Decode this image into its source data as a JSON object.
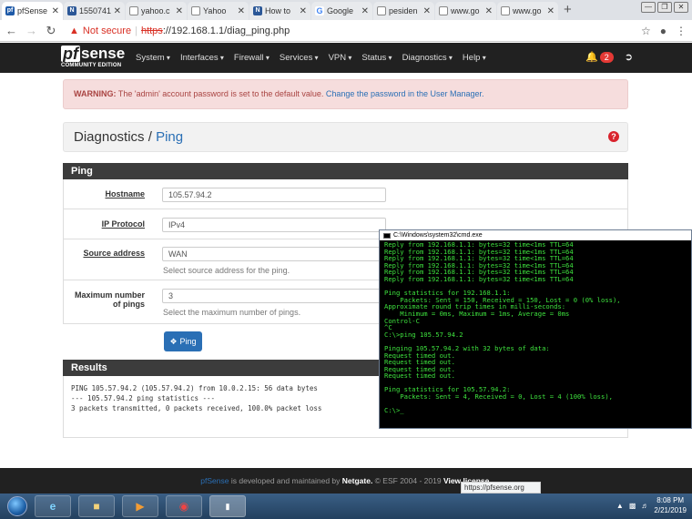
{
  "browser": {
    "tabs": [
      {
        "title": "pfSense",
        "icon": "pfsense-favicon",
        "active": true
      },
      {
        "title": "1550741",
        "icon": "netgate-favicon"
      },
      {
        "title": "yahoo.c",
        "icon": "document-favicon"
      },
      {
        "title": "Yahoo",
        "icon": "document-favicon"
      },
      {
        "title": "How to",
        "icon": "netgate-favicon"
      },
      {
        "title": "Google",
        "icon": "google-favicon"
      },
      {
        "title": "pesiden",
        "icon": "document-favicon"
      },
      {
        "title": "www.go",
        "icon": "document-favicon"
      },
      {
        "title": "www.go",
        "icon": "document-favicon"
      }
    ],
    "new_tab": "+",
    "security_label": "Not secure",
    "url_scheme": "https",
    "url_rest": "://192.168.1.1/diag_ping.php"
  },
  "nav": {
    "logo_pf": "pf",
    "logo_sense": "sense",
    "logo_edition": "COMMUNITY EDITION",
    "menu": [
      "System",
      "Interfaces",
      "Firewall",
      "Services",
      "VPN",
      "Status",
      "Diagnostics",
      "Help"
    ],
    "notification_count": "2"
  },
  "alert": {
    "prefix": "WARNING:",
    "message": " The 'admin' account password is set to the default value. ",
    "link": "Change the password in the User Manager."
  },
  "breadcrumb": {
    "section": "Diagnostics",
    "separator": " / ",
    "page": "Ping"
  },
  "ping_panel": {
    "title": "Ping",
    "hostname_label": "Hostname",
    "hostname_value": "105.57.94.2",
    "protocol_label": "IP Protocol",
    "protocol_value": "IPv4",
    "source_label": "Source address",
    "source_value": "WAN",
    "source_help": "Select source address for the ping.",
    "count_label_1": "Maximum number",
    "count_label_2": "of pings",
    "count_value": "3",
    "count_help": "Select the maximum number of pings.",
    "button_label": "Ping"
  },
  "results": {
    "title": "Results",
    "lines": [
      "PING 105.57.94.2 (105.57.94.2) from 10.0.2.15: 56 data bytes",
      "",
      "--- 105.57.94.2 ping statistics ---",
      "3 packets transmitted, 0 packets received, 100.0% packet loss"
    ]
  },
  "footer": {
    "brand": "pfSense",
    "text1": " is developed and maintained by ",
    "company": "Netgate.",
    "text2": " © ESF 2004 - 2019 ",
    "license": "View license."
  },
  "status_url": "https://pfsense.org",
  "cmd": {
    "title": "C:\\Windows\\system32\\cmd.exe",
    "lines": [
      "Reply from 192.168.1.1: bytes=32 time<1ms TTL=64",
      "Reply from 192.168.1.1: bytes=32 time<1ms TTL=64",
      "Reply from 192.168.1.1: bytes=32 time<1ms TTL=64",
      "Reply from 192.168.1.1: bytes=32 time<1ms TTL=64",
      "Reply from 192.168.1.1: bytes=32 time<1ms TTL=64",
      "Reply from 192.168.1.1: bytes=32 time<1ms TTL=64",
      "",
      "Ping statistics for 192.168.1.1:",
      "    Packets: Sent = 150, Received = 150, Lost = 0 (0% loss),",
      "Approximate round trip times in milli-seconds:",
      "    Minimum = 0ms, Maximum = 1ms, Average = 0ms",
      "Control-C",
      "^C",
      "C:\\>ping 105.57.94.2",
      "",
      "Pinging 105.57.94.2 with 32 bytes of data:",
      "Request timed out.",
      "Request timed out.",
      "Request timed out.",
      "Request timed out.",
      "",
      "Ping statistics for 105.57.94.2:",
      "    Packets: Sent = 4, Received = 0, Lost = 4 (100% loss),",
      "",
      "C:\\>_"
    ]
  },
  "taskbar": {
    "time": "8:08 PM",
    "date": "2/21/2019"
  },
  "colors": {
    "navbar": "#212121",
    "link": "#2a6fb5",
    "alert_bg": "#f6dddd",
    "cmd_text": "#3ee23e"
  }
}
